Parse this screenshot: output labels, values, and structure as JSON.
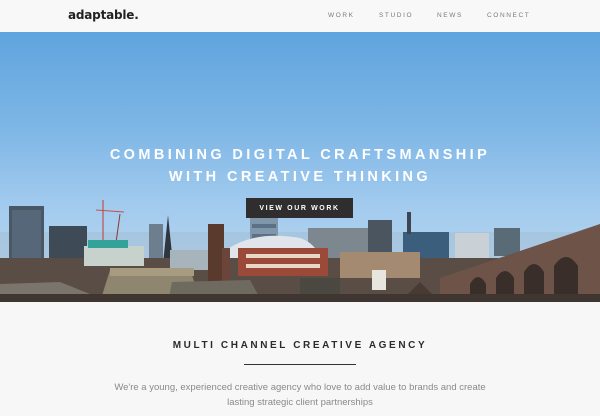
{
  "header": {
    "logo": "adaptable.",
    "nav": [
      {
        "label": "WORK"
      },
      {
        "label": "STUDIO"
      },
      {
        "label": "NEWS"
      },
      {
        "label": "CONNECT"
      }
    ]
  },
  "hero": {
    "headline_line1": "COMBINING DIGITAL CRAFTSMANSHIP",
    "headline_line2": "WITH CREATIVE THINKING",
    "cta_label": "VIEW OUR WORK"
  },
  "section": {
    "title": "MULTI CHANNEL CREATIVE AGENCY",
    "intro_line1": "We're a young, experienced creative agency who love to add value to brands and create",
    "intro_line2": "lasting strategic client partnerships"
  },
  "colors": {
    "sky_top": "#5fa4dd",
    "button_bg": "#2f2d2d",
    "text_dark": "#2b2b2b",
    "text_muted": "#8a8a8a"
  }
}
